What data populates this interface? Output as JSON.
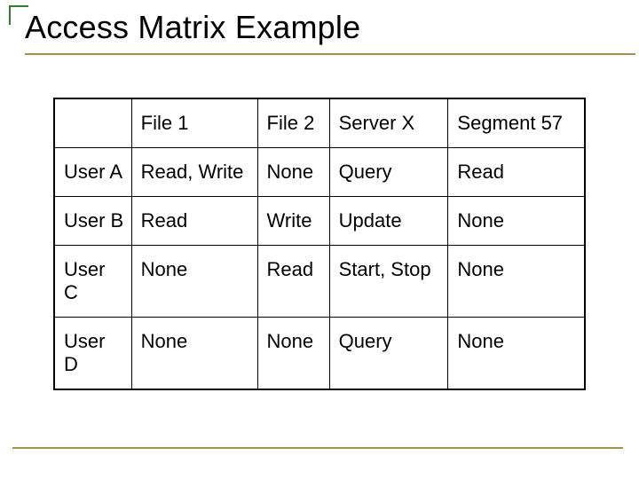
{
  "title": "Access Matrix Example",
  "chart_data": {
    "type": "table",
    "columns": [
      "",
      "File 1",
      "File 2",
      "Server X",
      "Segment 57"
    ],
    "rows": [
      [
        "User A",
        "Read, Write",
        "None",
        "Query",
        "Read"
      ],
      [
        "User B",
        "Read",
        "Write",
        "Update",
        "None"
      ],
      [
        "User C",
        "None",
        "Read",
        "Start, Stop",
        "None"
      ],
      [
        "User D",
        "None",
        "None",
        "Query",
        "None"
      ]
    ]
  }
}
